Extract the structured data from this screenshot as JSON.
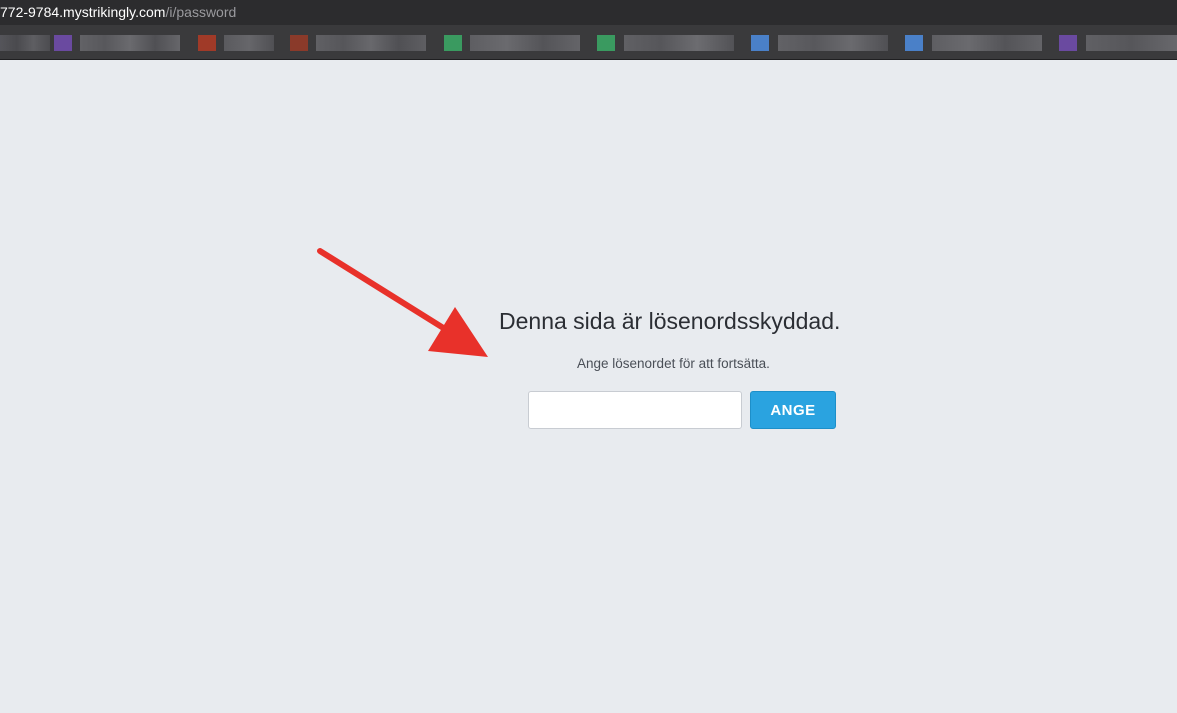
{
  "browser": {
    "url_host": "772-9784.mystrikingly.com",
    "url_path": "/i/password"
  },
  "bookmarks": {
    "blur_colors": [
      "#5a4a8a",
      "#9a3a2a",
      "#8a3a2a",
      "#3a8a5a",
      "#3a8a5a",
      "#4a7ac0",
      "#4a7ac0",
      "#6a4a9a"
    ]
  },
  "page": {
    "title": "Denna sida är lösenordsskyddad.",
    "subtitle": "Ange lösenordet för att fortsätta.",
    "password_value": "",
    "submit_label": "ANGE"
  },
  "colors": {
    "accent": "#2aa3e0",
    "arrow": "#e8312a",
    "background": "#e8ebef"
  }
}
